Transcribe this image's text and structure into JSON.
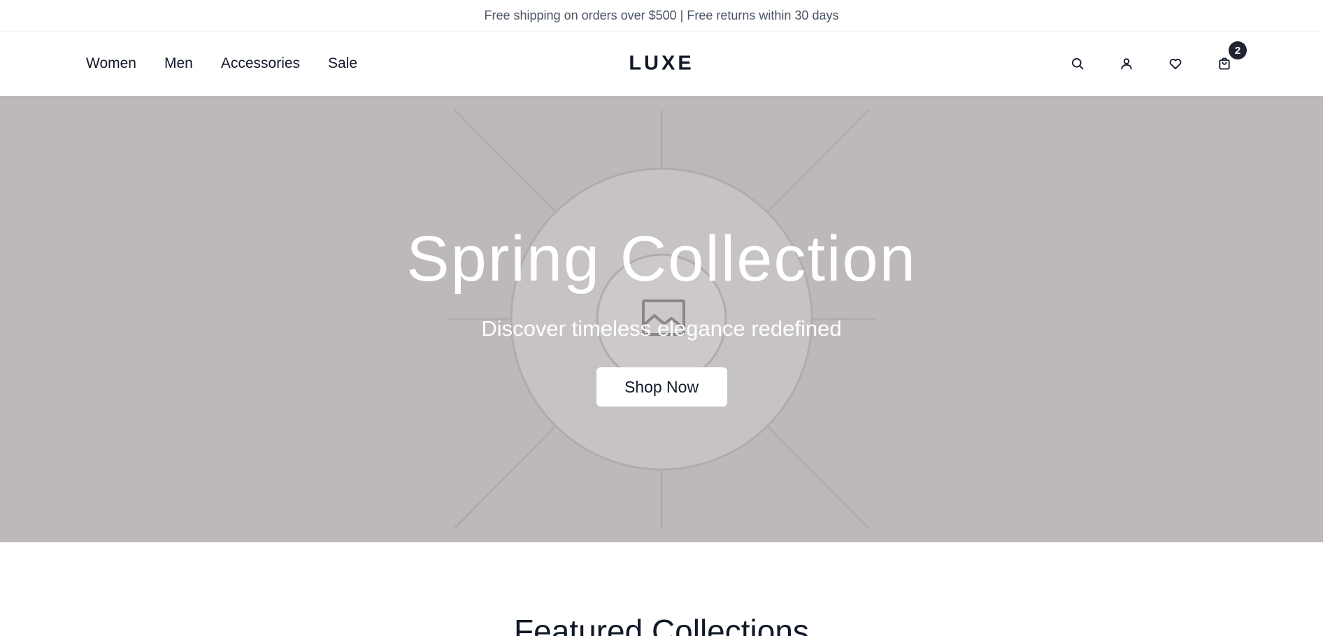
{
  "announcement": {
    "text": "Free shipping on orders over $500 | Free returns within 30 days"
  },
  "header": {
    "logo": "LUXE",
    "nav": [
      "Women",
      "Men",
      "Accessories",
      "Sale"
    ],
    "icons": [
      "search-icon",
      "account-icon",
      "wishlist-icon",
      "cart-icon"
    ],
    "cart_count": "2"
  },
  "hero": {
    "title": "Spring Collection",
    "subtitle": "Discover timeless elegance redefined",
    "cta": "Shop Now",
    "background_color": "#bdb9ba",
    "image_placeholder_icon": "image-icon"
  },
  "featured": {
    "title": "Featured Collections"
  },
  "colors": {
    "text_dark": "#111827",
    "badge_bg": "#1f2430",
    "announcement_text": "#4b5563"
  }
}
